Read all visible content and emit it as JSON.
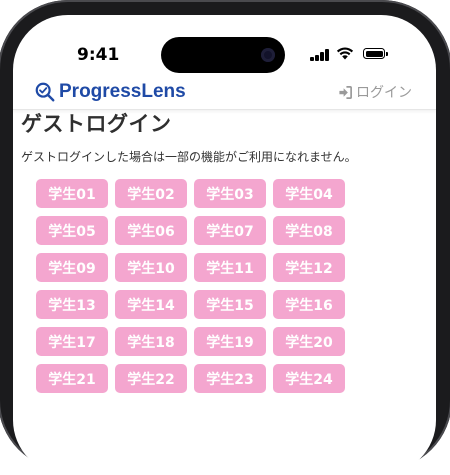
{
  "status_bar": {
    "time": "9:41"
  },
  "header": {
    "brand": "ProgressLens",
    "login_label": "ログイン"
  },
  "main": {
    "title": "ゲストログイン",
    "description": "ゲストログインした場合は一部の機能がご利用になれません。",
    "students": [
      "学生01",
      "学生02",
      "学生03",
      "学生04",
      "学生05",
      "学生06",
      "学生07",
      "学生08",
      "学生09",
      "学生10",
      "学生11",
      "学生12",
      "学生13",
      "学生14",
      "学生15",
      "学生16",
      "学生17",
      "学生18",
      "学生19",
      "学生20",
      "学生21",
      "学生22",
      "学生23",
      "学生24"
    ]
  },
  "colors": {
    "brand": "#1f4aa6",
    "student_button": "#f4a6cf",
    "login_link": "#9a9a9a"
  },
  "icons": {
    "logo": "magnifier-check-icon",
    "login": "sign-in-icon",
    "status": [
      "signal-icon",
      "wifi-icon",
      "battery-icon"
    ]
  }
}
